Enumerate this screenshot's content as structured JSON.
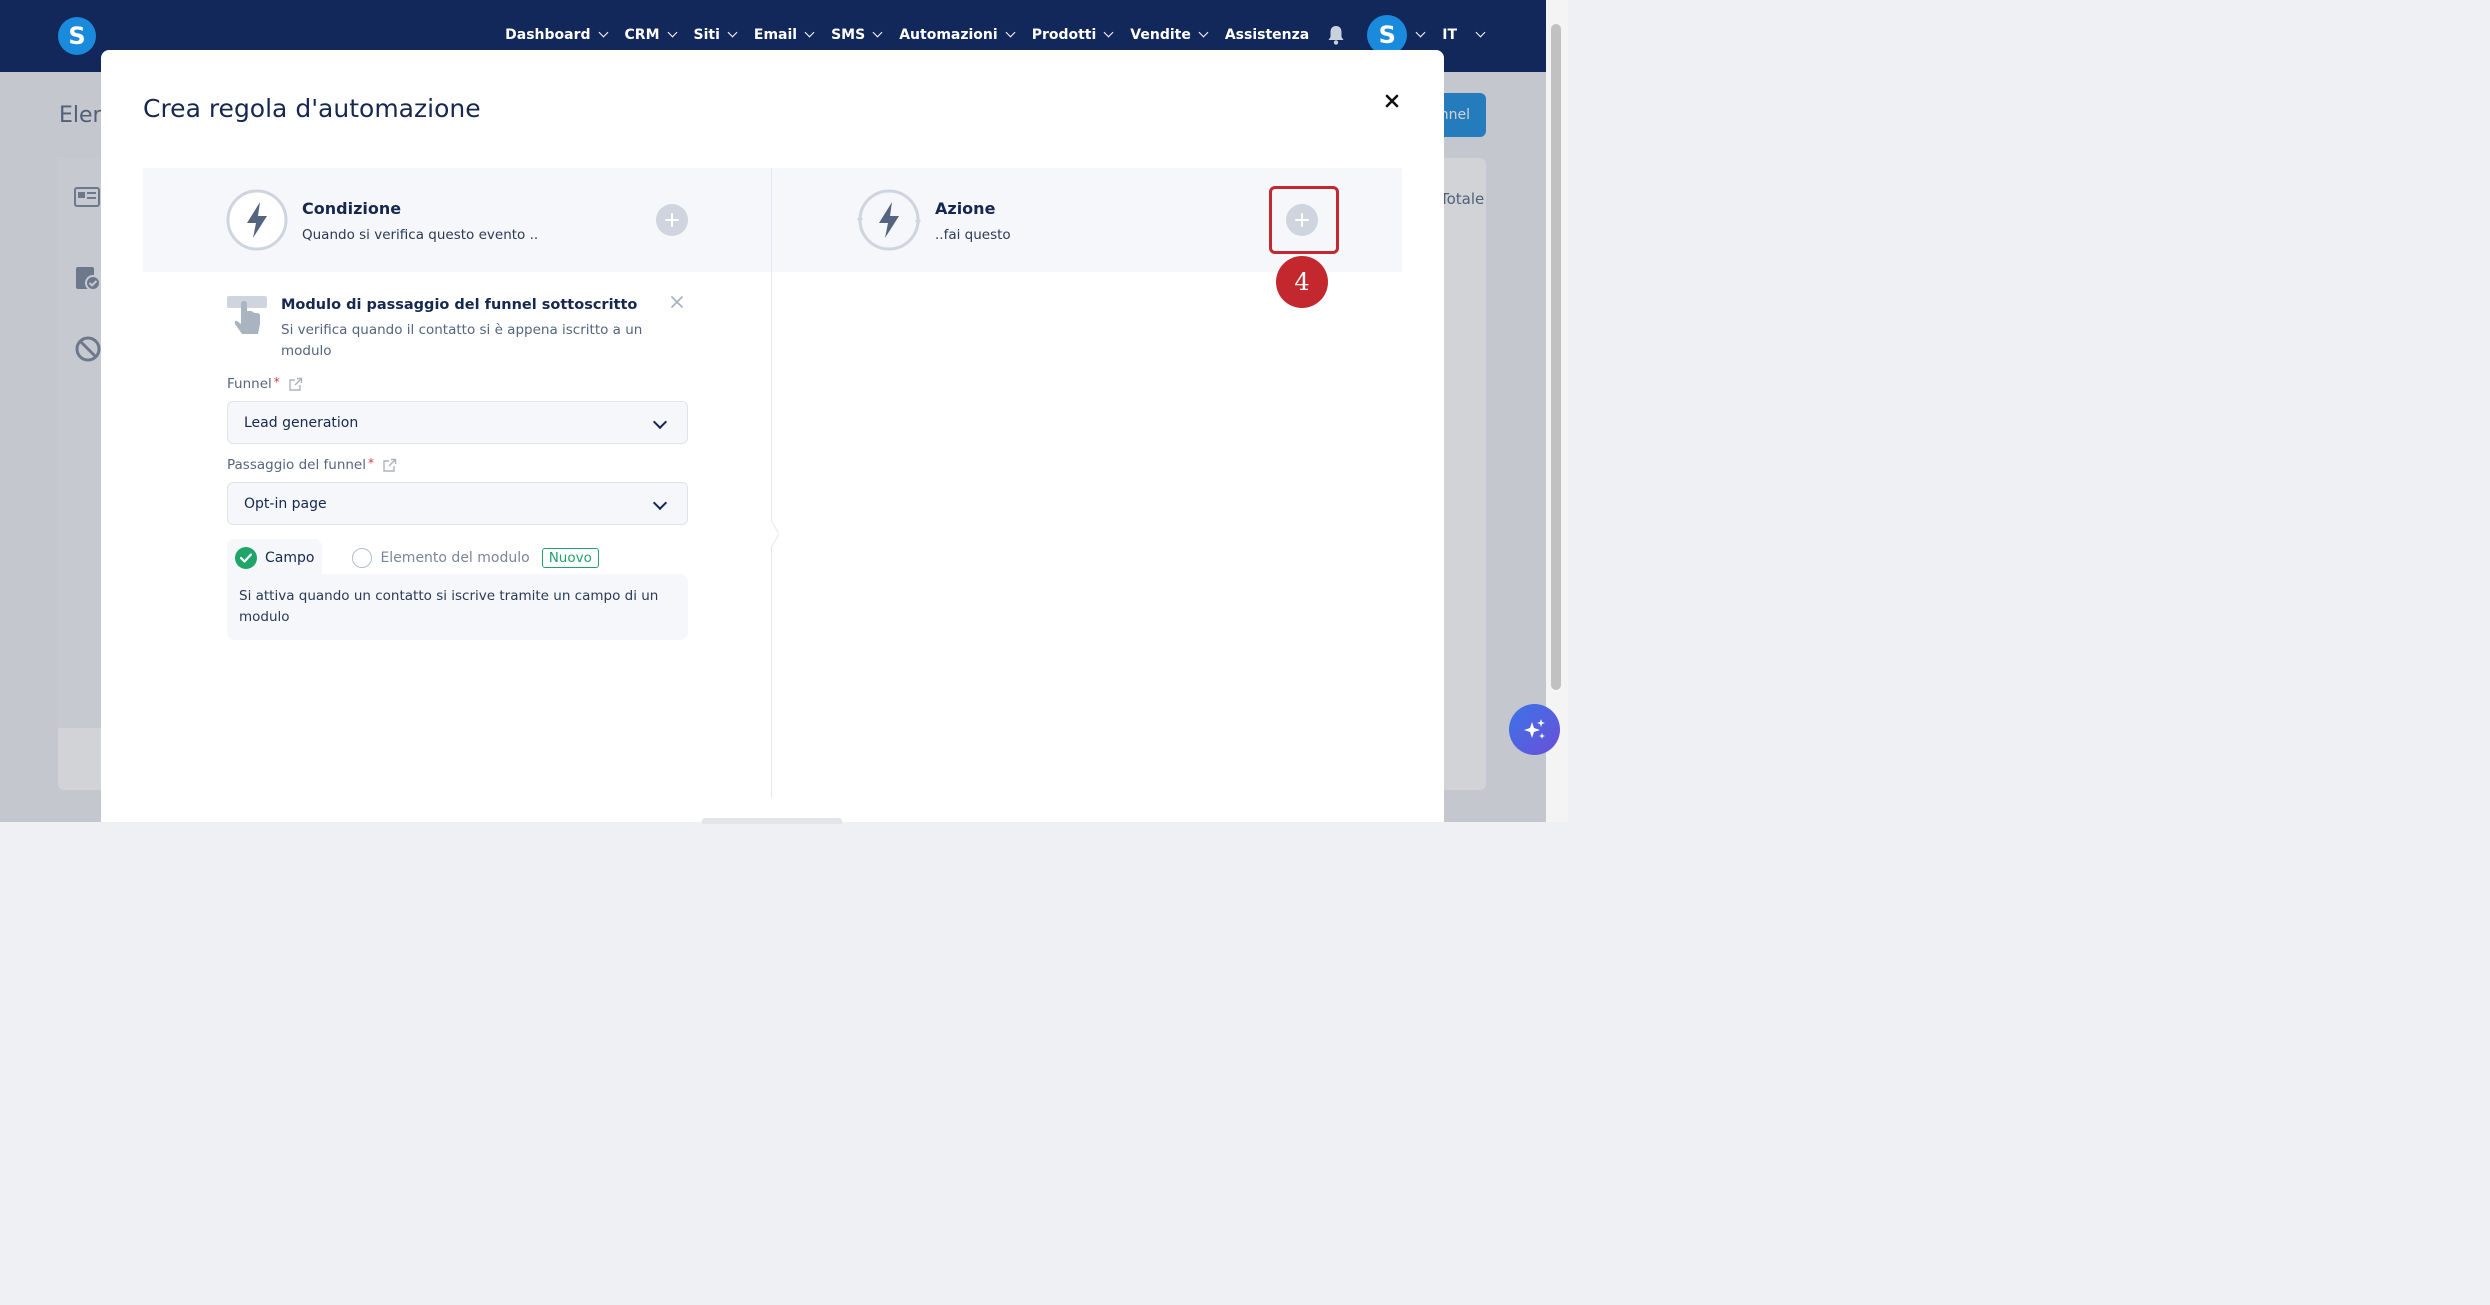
{
  "app": {
    "logo_letter": "S",
    "avatar_letter": "S",
    "language": "IT"
  },
  "nav": {
    "items": [
      {
        "label": "Dashboard",
        "has_dropdown": true
      },
      {
        "label": "CRM",
        "has_dropdown": true
      },
      {
        "label": "Siti",
        "has_dropdown": true
      },
      {
        "label": "Email",
        "has_dropdown": true
      },
      {
        "label": "SMS",
        "has_dropdown": true
      },
      {
        "label": "Automazioni",
        "has_dropdown": true
      },
      {
        "label": "Prodotti",
        "has_dropdown": true
      },
      {
        "label": "Vendite",
        "has_dropdown": true
      },
      {
        "label": "Assistenza",
        "has_dropdown": false
      }
    ]
  },
  "background": {
    "title_fragment": "Elen",
    "button_fragment": "nnel",
    "column_fragment": "Totale"
  },
  "modal": {
    "title": "Crea regola d'automazione",
    "condition": {
      "title": "Condizione",
      "subtitle": "Quando si verifica questo evento .."
    },
    "action": {
      "title": "Azione",
      "subtitle": "..fai questo"
    },
    "trigger": {
      "title": "Modulo di passaggio del funnel sottoscritto",
      "description": "Si verifica quando il contatto si è appena iscritto a un modulo"
    },
    "fields": {
      "funnel_label": "Funnel",
      "funnel_value": "Lead generation",
      "step_label": "Passaggio del funnel",
      "step_value": "Opt-in page",
      "required_mark": "*"
    },
    "tabs": {
      "active_label": "Campo",
      "inactive_label": "Elemento del modulo",
      "new_badge": "Nuovo",
      "panel_text": "Si attiva quando un contatto si iscrive tramite un campo di un modulo"
    }
  },
  "annotation": {
    "step_number": "4"
  },
  "colors": {
    "nav_bg": "#12275a",
    "brand_blue": "#1a8bdc",
    "highlight_red": "#c3282e",
    "success_green": "#1fa56a"
  }
}
